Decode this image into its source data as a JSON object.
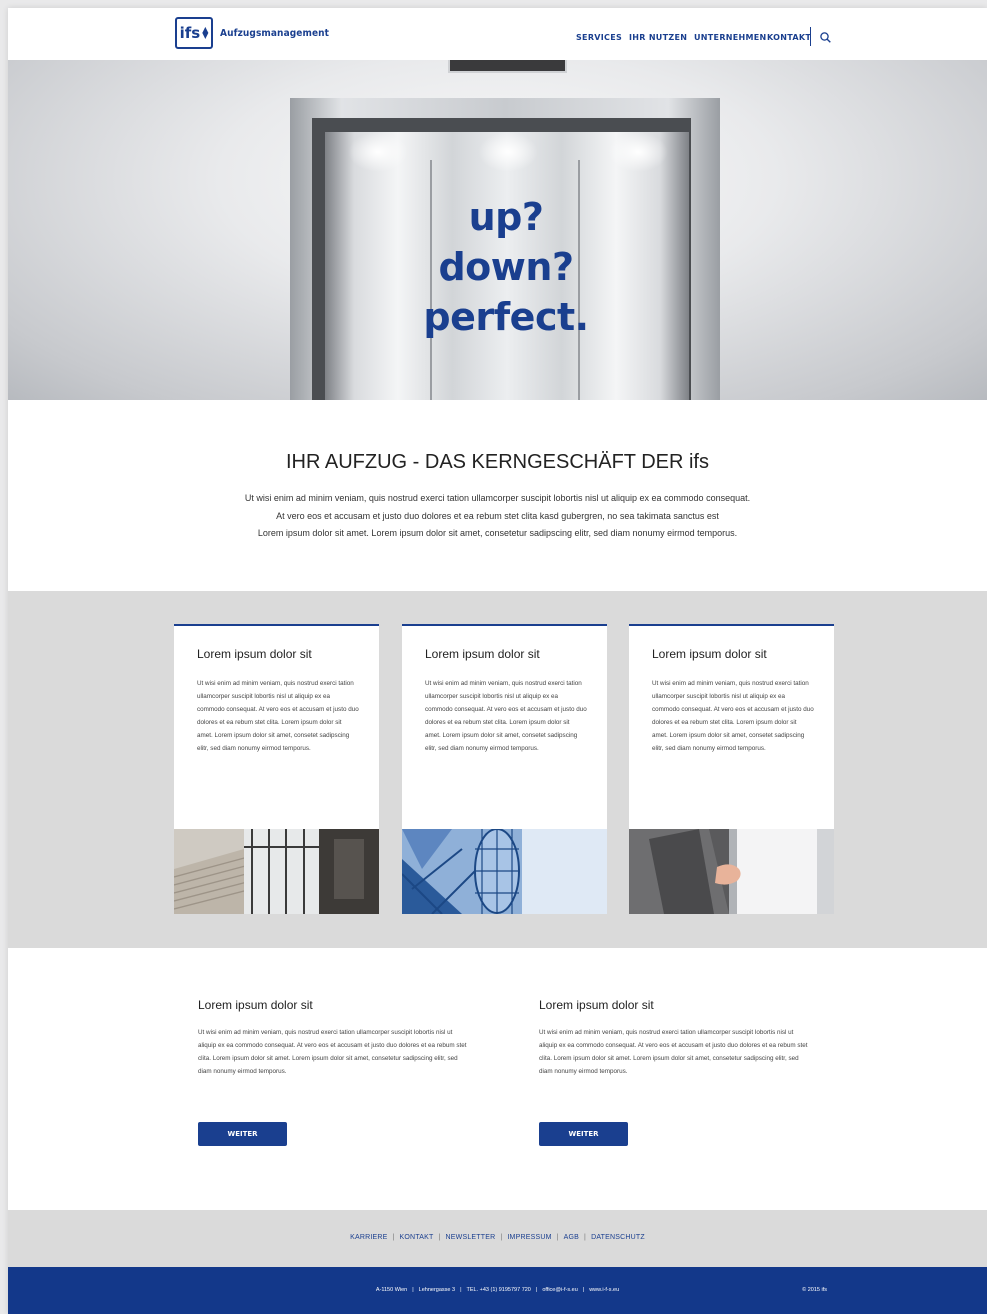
{
  "header": {
    "logo_mark": "ifs",
    "logo_text": "Aufzugsmanagement",
    "nav": [
      "SERVICES",
      "IHR NUTZEN",
      "UNTERNEHMEN",
      "KONTAKT"
    ],
    "search_icon": "search-icon"
  },
  "hero": {
    "line1": "up?",
    "line2": "down?",
    "line3": "perfect."
  },
  "intro": {
    "title": "IHR AUFZUG - DAS KERNGESCHÄFT DER ifs",
    "lines": [
      "Ut wisi enim ad minim veniam, quis nostrud exerci tation ullamcorper suscipit lobortis nisl ut aliquip ex ea commodo consequat.",
      "At vero eos et accusam et justo duo dolores et ea rebum stet clita kasd gubergren, no sea takimata sanctus est",
      "Lorem ipsum dolor sit amet. Lorem ipsum dolor sit amet, consetetur sadipscing elitr, sed diam nonumy eirmod temporus."
    ]
  },
  "cards": [
    {
      "title": "Lorem ipsum dolor sit",
      "text": "Ut wisi enim ad minim veniam, quis nostrud exerci tation ullamcorper suscipit lobortis nisl ut aliquip ex ea commodo consequat. At vero eos et accusam et justo duo dolores et ea rebum stet clita. Lorem ipsum dolor sit amet. Lorem ipsum dolor sit amet, consetet sadipscing elitr, sed diam nonumy eirmod temporus."
    },
    {
      "title": "Lorem ipsum dolor sit",
      "text": "Ut wisi enim ad minim veniam, quis nostrud exerci tation ullamcorper suscipit lobortis nisl ut aliquip ex ea commodo consequat. At vero eos et accusam et justo duo dolores et ea rebum stet clita. Lorem ipsum dolor sit amet. Lorem ipsum dolor sit amet, consetet sadipscing elitr, sed diam nonumy eirmod temporus."
    },
    {
      "title": "Lorem ipsum dolor sit",
      "text": "Ut wisi enim ad minim veniam, quis nostrud exerci tation ullamcorper suscipit lobortis nisl ut aliquip ex ea commodo consequat. At vero eos et accusam et justo duo dolores et ea rebum stet clita. Lorem ipsum dolor sit amet. Lorem ipsum dolor sit amet, consetet sadipscing elitr, sed diam nonumy eirmod temporus."
    }
  ],
  "columns": [
    {
      "title": "Lorem ipsum dolor sit",
      "text": "Ut wisi enim ad minim veniam, quis nostrud exerci tation ullamcorper suscipit lobortis nisl ut aliquip ex ea commodo consequat. At vero eos et accusam et justo duo dolores et ea rebum stet clita. Lorem ipsum dolor sit amet. Lorem ipsum dolor sit amet, consetetur sadipscing elitr, sed diam nonumy eirmod temporus.",
      "button": "WEITER"
    },
    {
      "title": "Lorem ipsum dolor sit",
      "text": "Ut wisi enim ad minim veniam, quis nostrud exerci tation ullamcorper suscipit lobortis nisl ut aliquip ex ea commodo consequat. At vero eos et accusam et justo duo dolores et ea rebum stet clita. Lorem ipsum dolor sit amet. Lorem ipsum dolor sit amet, consetetur sadipscing elitr, sed diam nonumy eirmod temporus.",
      "button": "WEITER"
    }
  ],
  "footer": {
    "links": [
      "KARRIERE",
      "KONTAKT",
      "NEWSLETTER",
      "IMPRESSUM",
      "AGB",
      "DATENSCHUTZ"
    ],
    "address": "A-1150 Wien",
    "street": "Lehnergasse 3",
    "phone": "TEL. +43 (1) 9195797 720",
    "email": "office@i-f-s.eu",
    "web": "www.i-f-s.eu",
    "copyright": "© 2015 ifs"
  },
  "colors": {
    "brand_blue": "#1a3f8f",
    "footer_blue": "#13388a",
    "section_gray": "#dadada"
  }
}
